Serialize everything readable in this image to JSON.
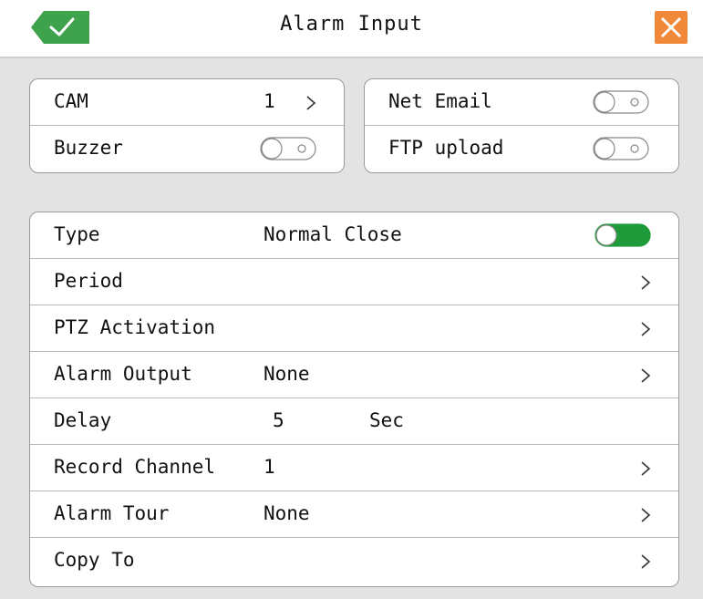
{
  "header": {
    "title": "Alarm Input",
    "ok_icon": "check-icon",
    "close_icon": "close-icon",
    "ok_color": "#3fa34d",
    "close_color": "#f0883a"
  },
  "top_left": {
    "cam_label": "CAM",
    "cam_value": "1",
    "buzzer_label": "Buzzer",
    "buzzer_on": false
  },
  "top_right": {
    "email_label": "Net Email",
    "email_on": false,
    "ftp_label": "FTP upload",
    "ftp_on": false
  },
  "settings": {
    "type_label": "Type",
    "type_value": "Normal Close",
    "type_on": true,
    "period_label": "Period",
    "ptz_label": "PTZ Activation",
    "alarm_output_label": "Alarm Output",
    "alarm_output_value": "None",
    "delay_label": "Delay",
    "delay_value": "5",
    "delay_unit": "Sec",
    "record_channel_label": "Record Channel",
    "record_channel_value": "1",
    "alarm_tour_label": "Alarm Tour",
    "alarm_tour_value": "None",
    "copy_to_label": "Copy To"
  },
  "colors": {
    "toggle_on": "#1e9a3a"
  }
}
